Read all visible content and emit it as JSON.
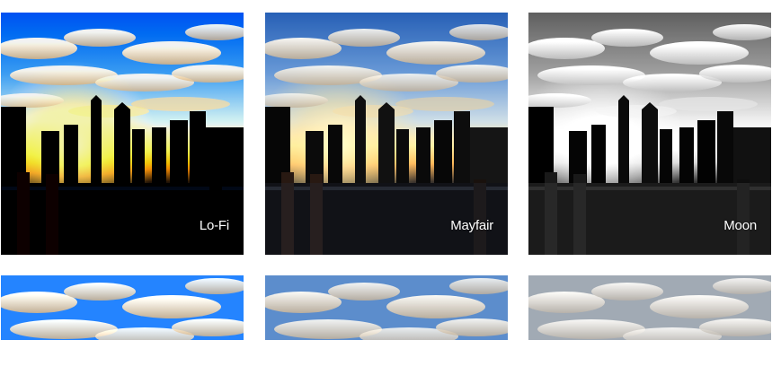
{
  "filters": [
    {
      "id": "lofi",
      "label": "Lo-Fi"
    },
    {
      "id": "mayfair",
      "label": "Mayfair"
    },
    {
      "id": "moon",
      "label": "Moon"
    }
  ],
  "colors": {
    "sky_top": "#3f6fb4",
    "sky_mid": "#8fb2d8",
    "sunset_glow": "#ffd27a",
    "skyline": "#0d0d0d"
  }
}
